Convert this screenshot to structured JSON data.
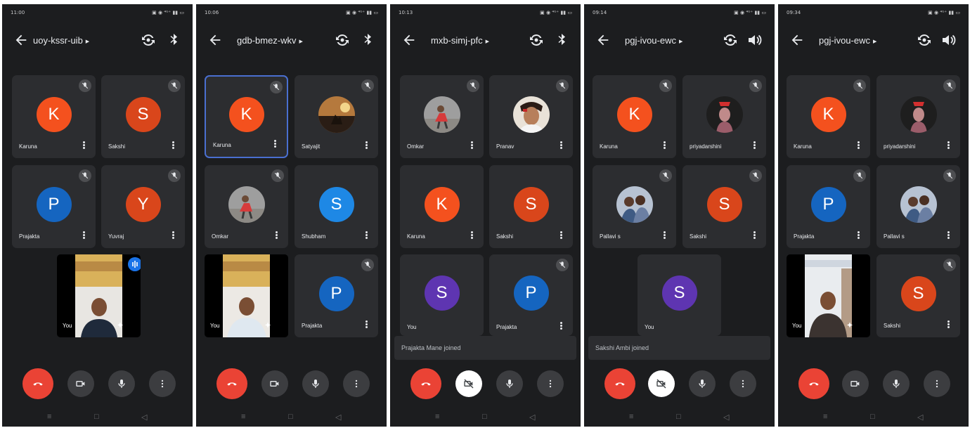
{
  "screens": [
    {
      "status_time": "11:00",
      "status_right": "▣ ◉ ⁴ᴳ⁺ ▮▮ ▭",
      "meeting_code": "uoy-kssr-uib",
      "right_icon": "bluetooth-icon",
      "tiles": [
        {
          "name": "Karuna",
          "initial": "K",
          "color": "#f4511e"
        },
        {
          "name": "Sakshi",
          "initial": "S",
          "color": "#d9461b"
        },
        {
          "name": "Prajakta",
          "initial": "P",
          "color": "#1565c0"
        },
        {
          "name": "Yuvraj",
          "initial": "Y",
          "color": "#d9461b"
        }
      ],
      "self_label": "You",
      "toast": ""
    },
    {
      "status_time": "10:06",
      "status_right": "▣ ◉ ⁴ᴳ⁺ ▮▮ ▭",
      "meeting_code": "gdb-bmez-wkv",
      "right_icon": "bluetooth-icon",
      "tiles": [
        {
          "name": "Karuna",
          "initial": "K",
          "color": "#f4511e"
        },
        {
          "name": "Satyajit",
          "initial": "",
          "color": "#3a2a20",
          "photo": "sunset"
        },
        {
          "name": "Omkar",
          "initial": "",
          "color": "#9a9a9a",
          "photo": "person"
        },
        {
          "name": "Shubham",
          "initial": "S",
          "color": "#1e88e5"
        },
        {
          "name": "Prajakta",
          "initial": "P",
          "color": "#1565c0"
        }
      ],
      "self_label": "You",
      "toast": ""
    },
    {
      "status_time": "10:13",
      "status_right": "▣ ◉ ⁴ᴳ⁺ ▮▮ ▭",
      "meeting_code": "mxb-simj-pfc",
      "right_icon": "bluetooth-icon",
      "tiles": [
        {
          "name": "Omkar",
          "initial": "",
          "color": "#9a9a9a",
          "photo": "person"
        },
        {
          "name": "Pranav",
          "initial": "",
          "color": "#e0d4c8",
          "photo": "face"
        },
        {
          "name": "Karuna",
          "initial": "K",
          "color": "#f4511e"
        },
        {
          "name": "Sakshi",
          "initial": "S",
          "color": "#d9461b"
        },
        {
          "name": "You",
          "initial": "S",
          "color": "#5e35b1"
        },
        {
          "name": "Prajakta",
          "initial": "P",
          "color": "#1565c0"
        }
      ],
      "self_label": "",
      "toast": "Prajakta Mane joined"
    },
    {
      "status_time": "09:14",
      "status_right": "▣ ◉ ⁴ᴳ⁺ ▮▮ ▭",
      "meeting_code": "pgj-ivou-ewc",
      "right_icon": "speaker-icon",
      "tiles": [
        {
          "name": "Karuna",
          "initial": "K",
          "color": "#f4511e"
        },
        {
          "name": "priyadarshini",
          "initial": "",
          "color": "#222",
          "photo": "dark"
        },
        {
          "name": "Pallavi s",
          "initial": "",
          "color": "#8a96a8",
          "photo": "group"
        },
        {
          "name": "Sakshi",
          "initial": "S",
          "color": "#d9461b"
        },
        {
          "name": "You",
          "initial": "S",
          "color": "#5e35b1"
        }
      ],
      "self_label": "",
      "toast": "Sakshi Ambi joined"
    },
    {
      "status_time": "09:34",
      "status_right": "▣ ◉ ⁴ᴳ⁺ ▮▮ ▭",
      "meeting_code": "pgj-ivou-ewc",
      "right_icon": "speaker-icon",
      "tiles": [
        {
          "name": "Karuna",
          "initial": "K",
          "color": "#f4511e"
        },
        {
          "name": "priyadarshini",
          "initial": "",
          "color": "#222",
          "photo": "dark"
        },
        {
          "name": "Prajakta",
          "initial": "P",
          "color": "#1565c0"
        },
        {
          "name": "Pallavi s",
          "initial": "",
          "color": "#8a96a8",
          "photo": "group"
        },
        {
          "name": "Sakshi",
          "initial": "S",
          "color": "#d9461b"
        }
      ],
      "self_label": "You",
      "toast": ""
    }
  ],
  "colors": {
    "end_call": "#ea4335",
    "bg": "#1c1d1f",
    "tile": "#2c2d30"
  }
}
